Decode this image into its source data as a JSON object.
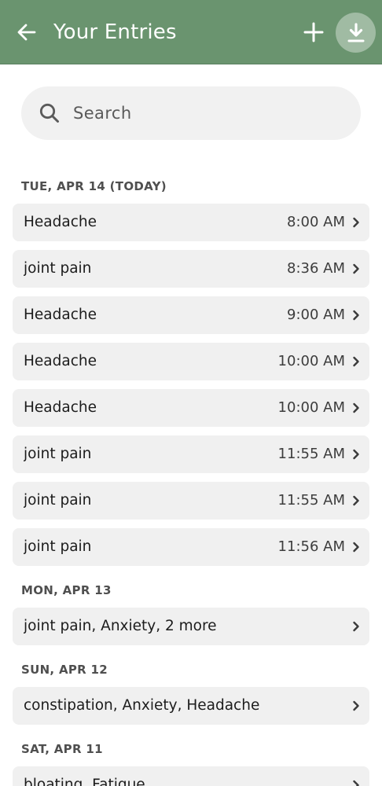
{
  "header": {
    "title": "Your Entries",
    "background": "#6a946f",
    "back_icon": "arrow-left-icon",
    "add_icon": "plus-icon",
    "download_icon": "download-icon"
  },
  "search": {
    "placeholder": "Search",
    "value": "",
    "icon": "search-icon"
  },
  "groups": [
    {
      "date": "TUE, APR 14 (TODAY)",
      "entries": [
        {
          "label": "Headache",
          "time": "8:00 AM"
        },
        {
          "label": "joint pain",
          "time": "8:36 AM"
        },
        {
          "label": "Headache",
          "time": "9:00 AM"
        },
        {
          "label": "Headache",
          "time": "10:00 AM"
        },
        {
          "label": "Headache",
          "time": "10:00 AM"
        },
        {
          "label": "joint pain",
          "time": "11:55 AM"
        },
        {
          "label": "joint pain",
          "time": "11:55 AM"
        },
        {
          "label": "joint pain",
          "time": "11:56 AM"
        }
      ]
    },
    {
      "date": "MON, APR 13",
      "entries": [
        {
          "label": "joint pain, Anxiety, 2 more",
          "time": ""
        }
      ]
    },
    {
      "date": "SUN, APR 12",
      "entries": [
        {
          "label": "constipation, Anxiety, Headache",
          "time": ""
        }
      ]
    },
    {
      "date": "SAT, APR 11",
      "entries": [
        {
          "label": "bloating, Fatigue",
          "time": ""
        }
      ]
    }
  ]
}
